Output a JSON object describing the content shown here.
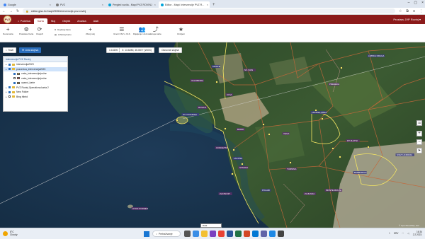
{
  "browser": {
    "tabs": [
      {
        "title": "Google",
        "color": "#4285f4"
      },
      {
        "title": "PVZ",
        "color": "#7a7a7a"
      },
      {
        "title": "Pregled vozila - Mapi PVZ ROVINJ",
        "color": "#00a3d9"
      },
      {
        "title": "Editor - Mapi: Intervencije PVZ R...",
        "color": "#00a3d9"
      }
    ],
    "url": "editor.gisc.hr/map/2935/intervencije-pvz-rovinj"
  },
  "app": {
    "logo_text": "PVZ",
    "nav_tabs": [
      "Početna",
      "Karta",
      "Sloj",
      "Objekt",
      "Analiza",
      "Alati"
    ],
    "active_tab": "Karta",
    "user": "Prostrav JVP Rovinj"
  },
  "ribbon": {
    "buttons": [
      {
        "label": "Nova karta",
        "icon": "plus-icon"
      },
      {
        "label": "Postavke Karte",
        "icon": "gear-icon"
      },
      {
        "label": "Osvježi",
        "icon": "refresh-icon"
      },
      {
        "label": "Zbroji sloj",
        "icon": "plus-icon"
      },
      {
        "label": "Izvezi CSV u XLS",
        "icon": "list-icon"
      },
      {
        "label": "Dijeljenje i dozvole",
        "icon": "users-icon"
      },
      {
        "label": "Grupe karte",
        "icon": "share-icon"
      },
      {
        "label": "Omiljeni",
        "icon": "star-icon"
      }
    ],
    "small_items": [
      "Duplicaj Kartu",
      "Arhiviraj Kartu",
      "Uredi Kartu"
    ]
  },
  "map_toolbar": {
    "back_label": "Traži",
    "layers_toggle": "Lista slojeva",
    "coords": "X: 13.6280, 45.0877 (WGS)",
    "scale_select": "1:16190",
    "extra": "Osnovne slojeve"
  },
  "layers": {
    "title": "Intervencije PVZ Rovinj",
    "items": [
      {
        "name": "intervencija2023",
        "checked": true,
        "type": "folder",
        "selected": false
      },
      {
        "name": "pozornica_intervencija2023",
        "checked": true,
        "type": "folder",
        "selected": true
      },
      {
        "name": "vrsta_intervencije/požar",
        "checked": true,
        "type": "swatch",
        "color": "#f5c542",
        "selected": false
      },
      {
        "name": "vrsta_intervencije/požar",
        "checked": false,
        "type": "swatch",
        "color": "#e44",
        "selected": false
      },
      {
        "name": "opseci_karte",
        "checked": true,
        "type": "swatch",
        "color": "#c98a2e",
        "selected": false
      },
      {
        "name": "PVZ Rovinj Operativna karta 2",
        "checked": true,
        "type": "folder",
        "selected": false
      },
      {
        "name": "New Folder",
        "checked": true,
        "type": "folder",
        "selected": false
      },
      {
        "name": "Bing hibrid",
        "checked": false,
        "type": "folder",
        "selected": false
      }
    ]
  },
  "map_labels": [
    "SV. KATARINA",
    "ROVINJ",
    "VALDIBORA",
    "MONTE",
    "CUVI",
    "CONCETTA",
    "LACOSA",
    "STANGA",
    "ZLATNI RT",
    "POLARI",
    "BORIK",
    "VEGA",
    "LACOSA-AREA",
    "SV. IVAN",
    "RT ZLATNI",
    "BARBARIGA",
    "TURNINA",
    "PRESEKA",
    "LIMSKA DRAGA",
    "ZUJUNIJA",
    "MONTE MULINI",
    "SVETI ANDRIJA",
    "OTOK POREER"
  ],
  "scale_label": "Data",
  "attribution": "© OpenStreetMap, Esri",
  "taskbar": {
    "weather_temp": "8°C",
    "weather_desc": "Cloudy",
    "search_label": "Pretraživanje",
    "time": "16:34",
    "date": "2.2.2023.",
    "lang": "HRV"
  }
}
